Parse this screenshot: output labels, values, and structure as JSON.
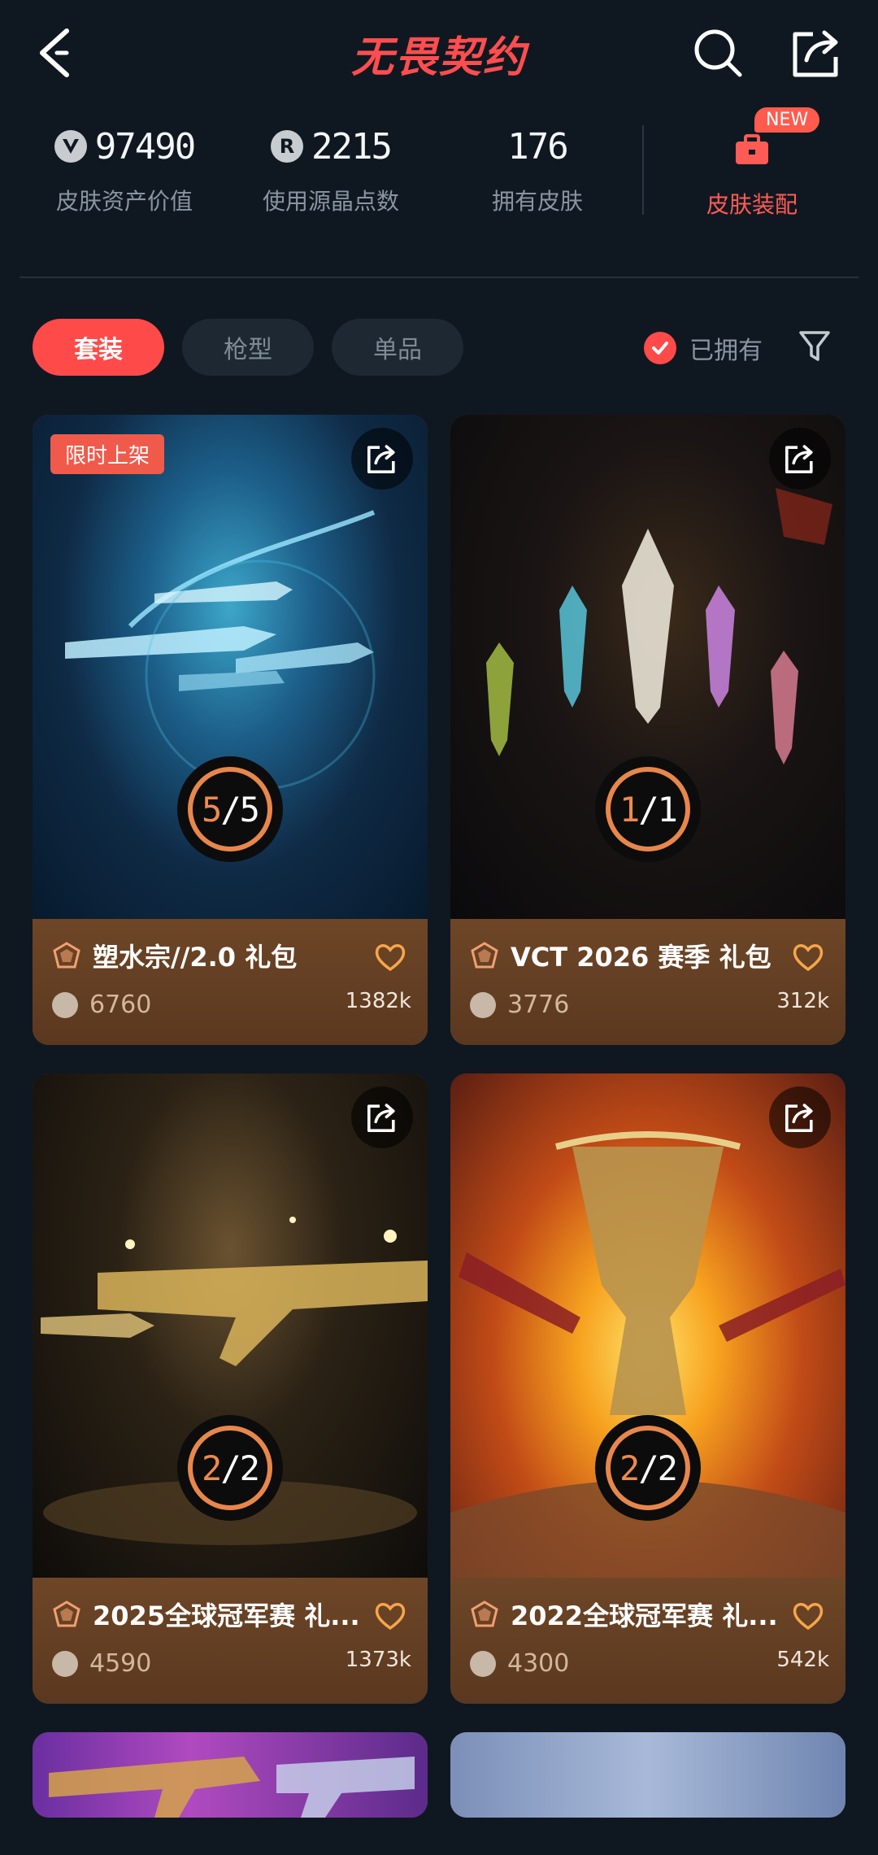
{
  "header": {
    "title": "无畏契约"
  },
  "stats": [
    {
      "value": "97490",
      "label": "皮肤资产价值",
      "icon": "valorant-point-icon"
    },
    {
      "value": "2215",
      "label": "使用源晶点数",
      "icon": "radianite-icon"
    },
    {
      "value": "176",
      "label": "拥有皮肤"
    }
  ],
  "equip": {
    "label": "皮肤装配",
    "badge": "NEW"
  },
  "tabs": [
    {
      "label": "套装",
      "active": true
    },
    {
      "label": "枪型",
      "active": false
    },
    {
      "label": "单品",
      "active": false
    }
  ],
  "owned_filter": {
    "label": "已拥有",
    "checked": true
  },
  "radianite_letter": "R",
  "cards": [
    {
      "limited_tag": "限时上架",
      "owned": "5",
      "total": "5",
      "name": "塑水宗//2.0 礼包",
      "price": "6760",
      "likes": "1382k"
    },
    {
      "owned": "1",
      "total": "1",
      "name": "VCT 2026 赛季 礼包",
      "price": "3776",
      "likes": "312k"
    },
    {
      "owned": "2",
      "total": "2",
      "name": "2025全球冠军赛 礼...",
      "price": "4590",
      "likes": "1373k"
    },
    {
      "owned": "2",
      "total": "2",
      "name": "2022全球冠军赛 礼...",
      "price": "4300",
      "likes": "542k"
    }
  ],
  "colors": {
    "accent": "#ff4a4a",
    "ring": "#e8874b",
    "background": "#0f1821",
    "card_info": "#6b4427"
  }
}
